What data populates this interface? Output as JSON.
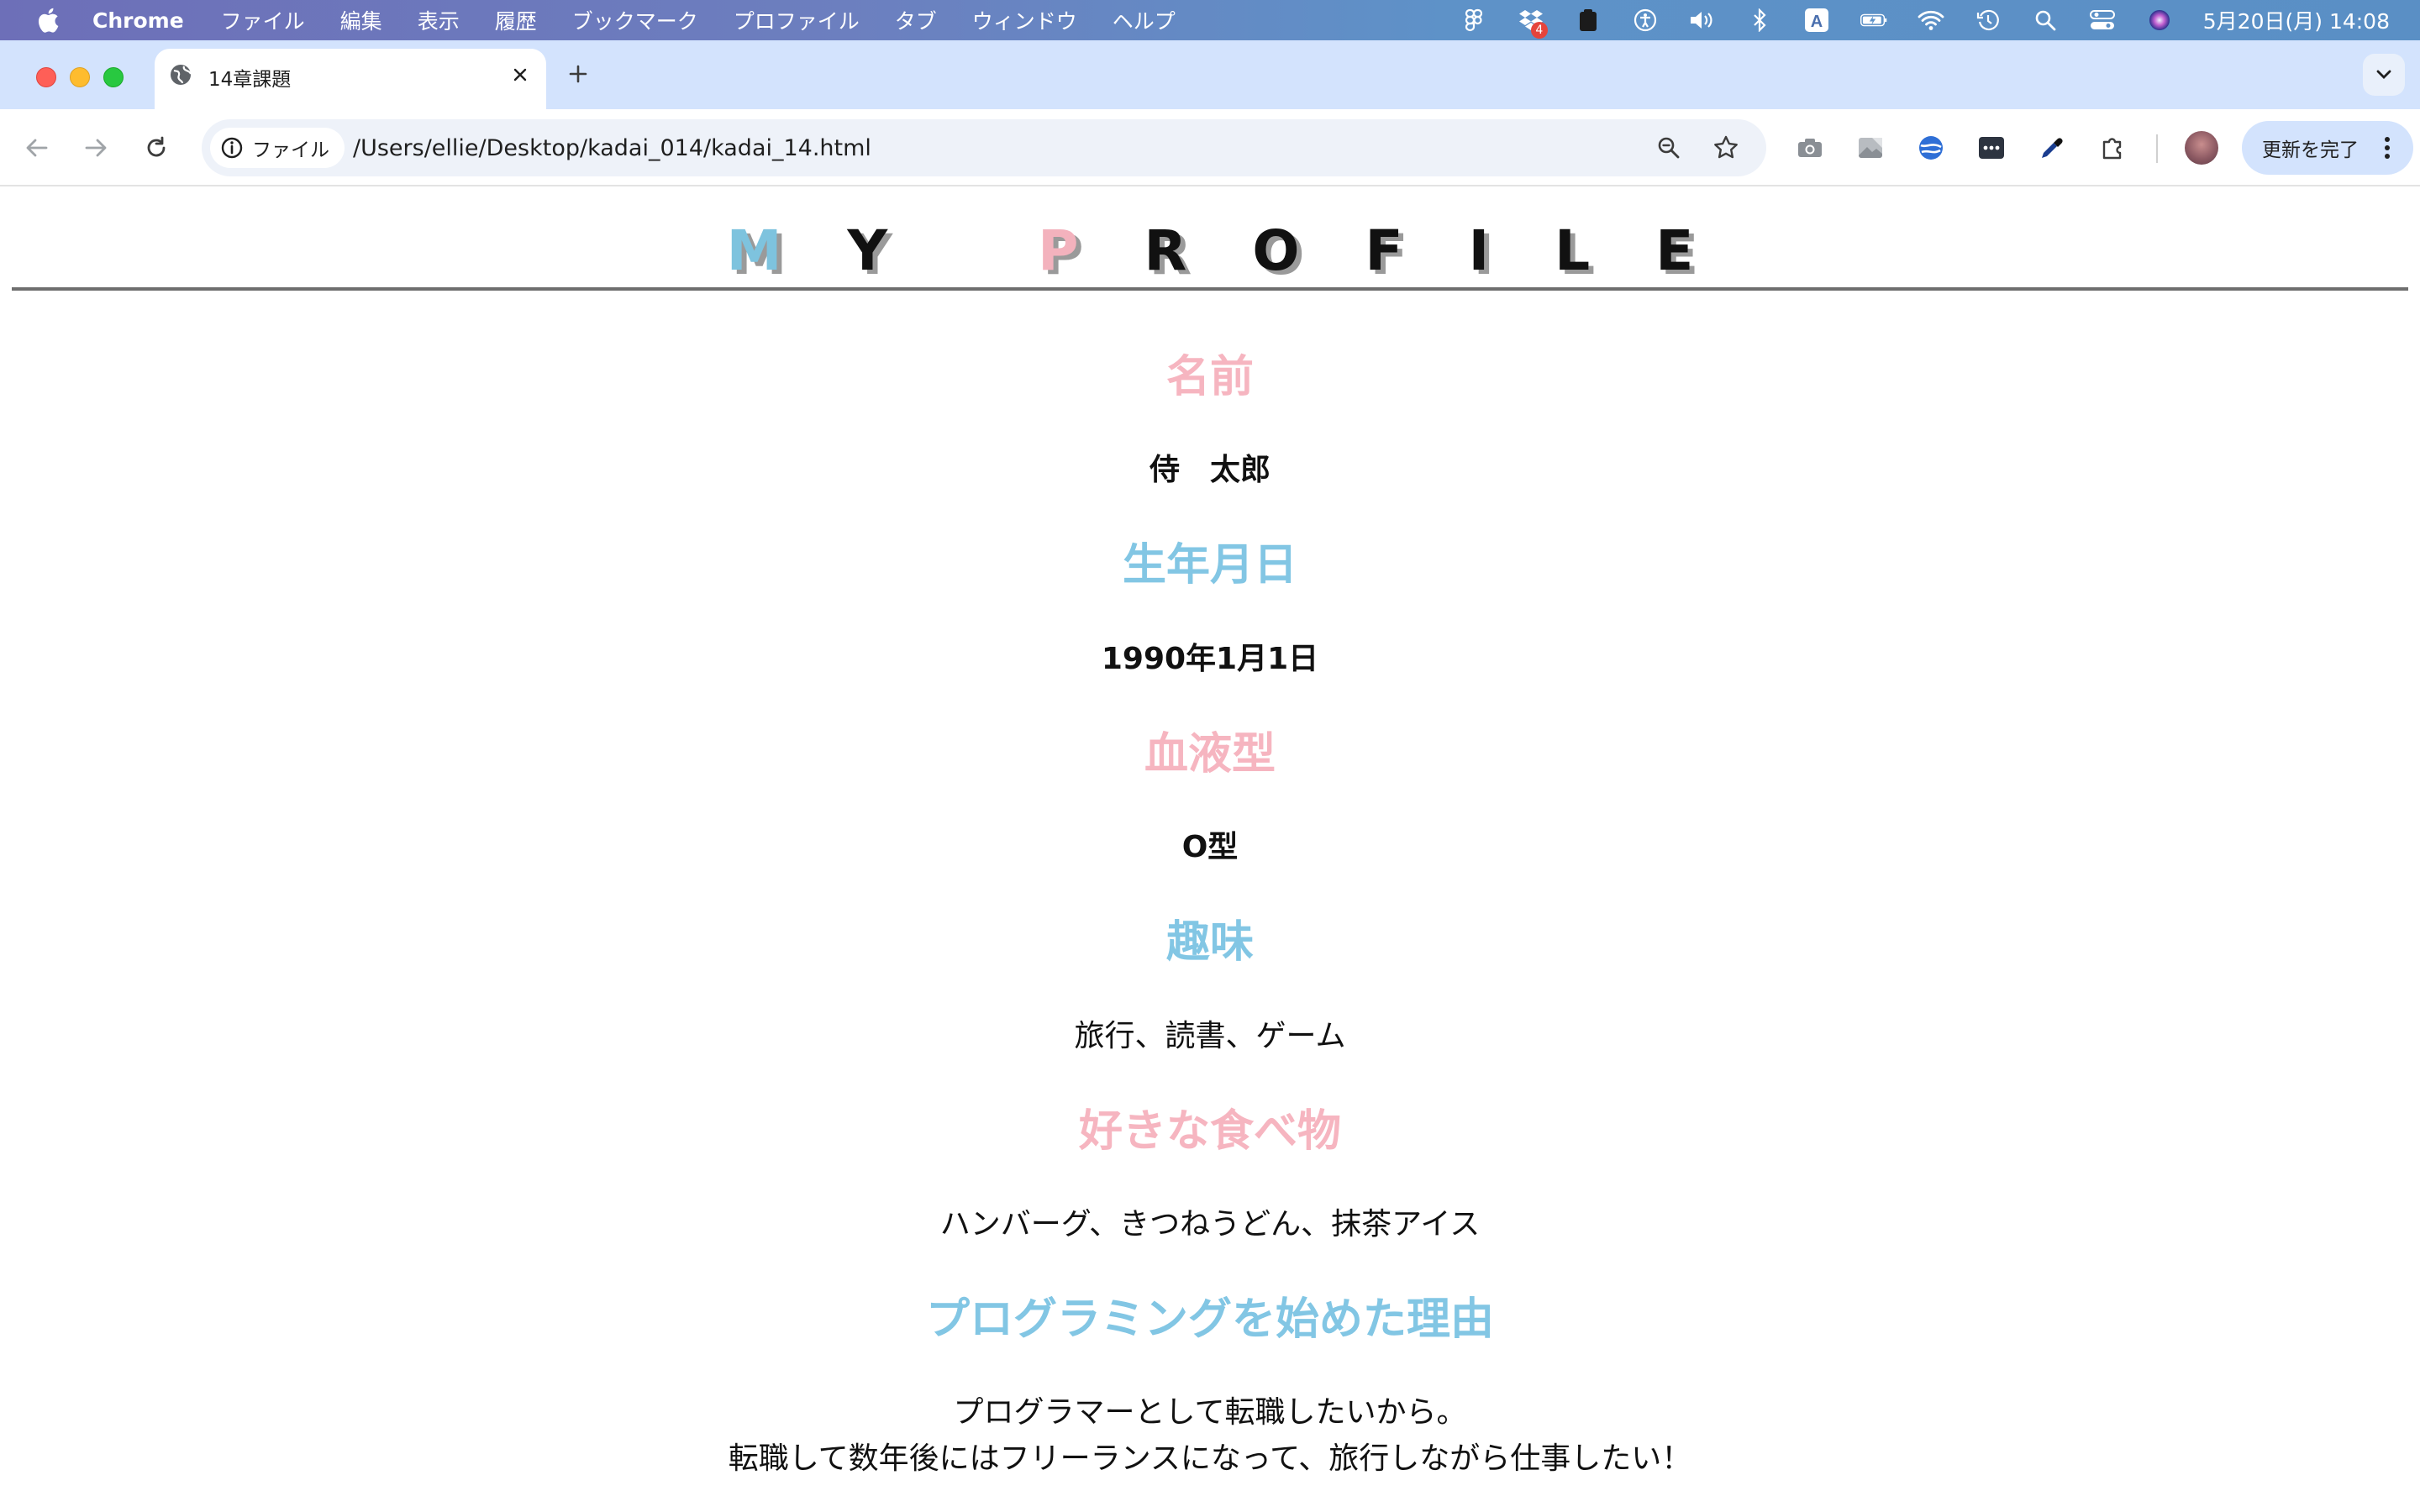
{
  "menubar": {
    "app": "Chrome",
    "items": [
      "ファイル",
      "編集",
      "表示",
      "履歴",
      "ブックマーク",
      "プロファイル",
      "タブ",
      "ウィンドウ",
      "ヘルプ"
    ],
    "dropbox_badge": "4",
    "input_indicator": "A",
    "clock": "5月20日(月)  14:08"
  },
  "tab": {
    "title": "14章課題"
  },
  "toolbar": {
    "chip_label": "ファイル",
    "url": "/Users/ellie/Desktop/kadai_014/kadai_14.html",
    "update_label": "更新を完了"
  },
  "page": {
    "title_letters": [
      "M",
      "Y",
      " ",
      "P",
      "R",
      "O",
      "F",
      "I",
      "L",
      "E"
    ],
    "sections": [
      {
        "heading": "名前",
        "color": "pink",
        "body": [
          "侍　太郎"
        ],
        "bold": true
      },
      {
        "heading": "生年月日",
        "color": "blue",
        "body": [
          "1990年1月1日"
        ],
        "bold": true
      },
      {
        "heading": "血液型",
        "color": "pink",
        "body": [
          "O型"
        ],
        "bold": true
      },
      {
        "heading": "趣味",
        "color": "blue",
        "body": [
          "旅行、読書、ゲーム"
        ],
        "bold": false
      },
      {
        "heading": "好きな食べ物",
        "color": "pink",
        "body": [
          "ハンバーグ、きつねうどん、抹茶アイス"
        ],
        "bold": false
      },
      {
        "heading": "プログラミングを始めた理由",
        "color": "blue",
        "body": [
          "プログラマーとして転職したいから。",
          "転職して数年後にはフリーランスになって、旅行しながら仕事したい！"
        ],
        "bold": false
      }
    ]
  },
  "colors": {
    "pink": "#f6b5c0",
    "blue": "#82c6e4"
  }
}
